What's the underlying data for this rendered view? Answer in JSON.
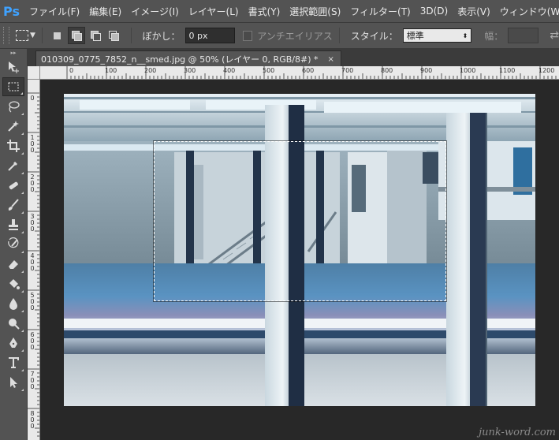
{
  "menubar": {
    "logo": "Ps",
    "items": [
      "ファイル(F)",
      "編集(E)",
      "イメージ(I)",
      "レイヤー(L)",
      "書式(Y)",
      "選択範囲(S)",
      "フィルター(T)",
      "3D(D)",
      "表示(V)",
      "ウィンドウ(W)"
    ]
  },
  "options": {
    "feather_label": "ぼかし：",
    "feather_value": "0 px",
    "antialias_label": "アンチエイリアス",
    "style_label": "スタイル：",
    "style_value": "標準",
    "width_label": "幅："
  },
  "document": {
    "tab_title": "010309_0775_7852_n__smed.jpg @ 50% (レイヤー 0, RGB/8#) *",
    "close_glyph": "×"
  },
  "rulers": {
    "top_labels": [
      "0",
      "100",
      "200",
      "300",
      "400",
      "500",
      "600",
      "700",
      "800",
      "900",
      "1000",
      "1100",
      "1200"
    ],
    "left_labels": [
      "0",
      "1 0 0",
      "2 0 0",
      "3 0 0",
      "4 0 0",
      "5 0 0",
      "6 0 0",
      "7 0 0",
      "8 0 0"
    ]
  },
  "watermark": "junk-word.com",
  "colors": {
    "ui_dark": "#535353",
    "canvas_bg": "#282828",
    "ps_blue": "#3fa2ff"
  }
}
